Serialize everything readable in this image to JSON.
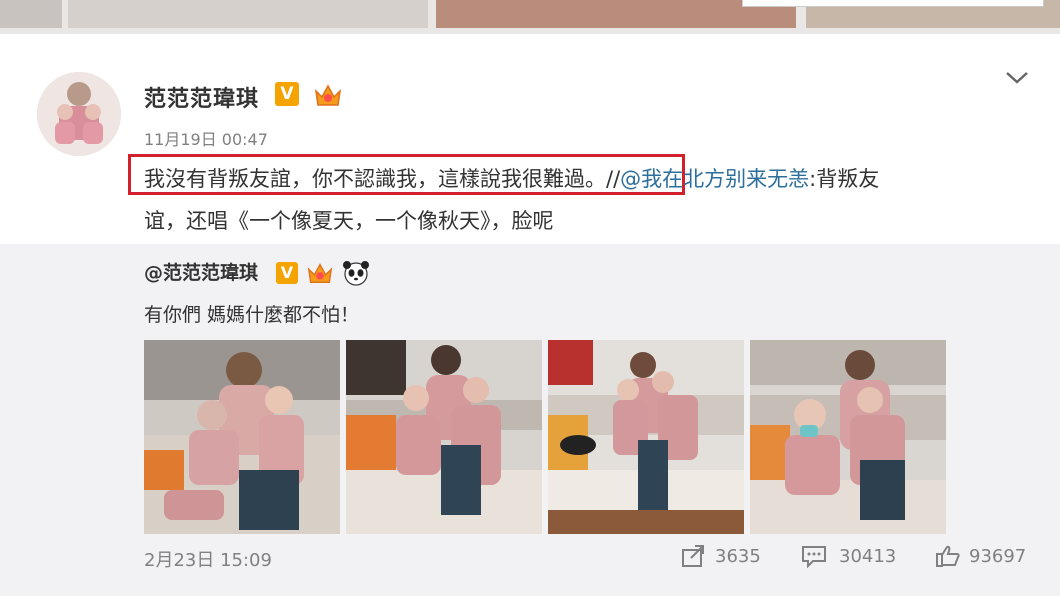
{
  "post": {
    "username": "范范范瑋琪",
    "verified_badge": "V",
    "timestamp": "11月19日 00:47",
    "text_highlighted": "我沒有背叛友誼，你不認識我，這樣說我很難過。",
    "text_sep": "//",
    "mention": "@我在北方别来无恙",
    "text_after_mention": ":背叛友",
    "text_line2": "谊，还唱《一个像夏天，一个像秋天》，脸呢"
  },
  "repost": {
    "username": "@范范范瑋琪",
    "verified_badge": "V",
    "text": "有你們 媽媽什麼都不怕！",
    "photo_count": 4,
    "date": "2月23日 15:09",
    "shares": "3635",
    "comments": "30413",
    "likes": "93697"
  },
  "icons": {
    "share": "share-icon",
    "comment": "comment-icon",
    "like": "thumbs-up-icon",
    "more": "chevron-down-icon",
    "crown": "crown-icon",
    "panda": "panda-emoji-icon"
  },
  "colors": {
    "highlight_border": "#d4202d",
    "mention": "#2c6e9c",
    "verified": "#f5a300"
  }
}
